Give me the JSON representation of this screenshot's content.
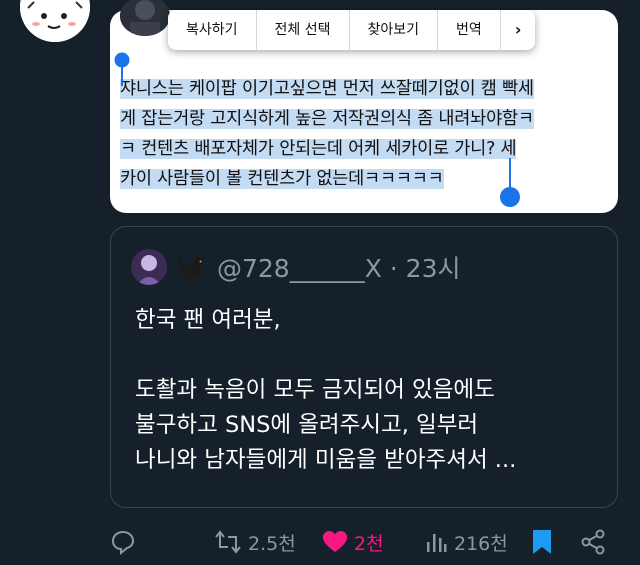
{
  "context_menu": {
    "items": [
      "복사하기",
      "전체 선택",
      "찾아보기",
      "번역"
    ],
    "more": "›"
  },
  "tweet": {
    "selected_lines": [
      "쟈니스는 케이팝 이기고싶으면 먼저  쓰잘떼기없이 캠 빡세",
      "게 잡는거랑 고지식하게 높은 저작권의식 좀 내려놔야함ㅋ",
      "ㅋ 컨텐츠 배포자체가 안되는데 어케 세카이로 가니? 세",
      "카이 사람들이 볼 컨텐츠가 없는데ㅋㅋㅋㅋㅋ"
    ]
  },
  "quote": {
    "handle": "@728______X · 23시",
    "lines": [
      "한국 팬 여러분,",
      "",
      " 도촬과 녹음이 모두 금지되어 있음에도",
      "불구하고 SNS에 올려주시고, 일부러",
      "나니와 남자들에게 미움을 받아주셔서 ..."
    ]
  },
  "actions": {
    "retweets": "2.5천",
    "likes": "2천",
    "views": "216천"
  },
  "colors": {
    "background": "#15202b",
    "selection": "#c4dbf4",
    "handle": "#1a73e8",
    "like": "#f91880",
    "bookmark": "#1d9bf0",
    "muted": "#8899a6"
  }
}
